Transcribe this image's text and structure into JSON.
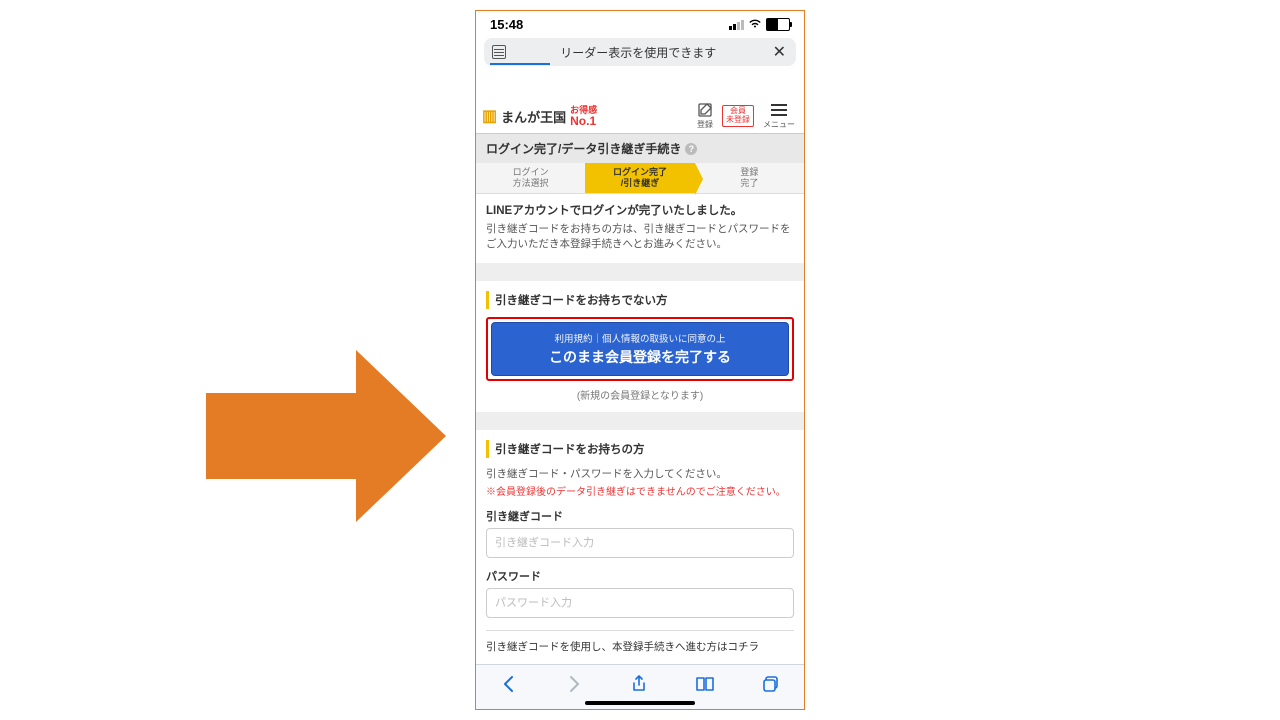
{
  "status": {
    "time": "15:48"
  },
  "urlbar": {
    "reader_text": "リーダー表示を使用できます"
  },
  "appheader": {
    "brand": "まんが王国",
    "otoku_top": "お得感",
    "otoku_bottom": "No.1",
    "register_label": "登録",
    "unregistered_badge": "会員\n未登録",
    "menu_label": "メニュー"
  },
  "page_title": "ログイン完了/データ引き継ぎ手続き",
  "steps": {
    "s1": "ログイン\n方法選択",
    "s2": "ログイン完了\n/引き継ぎ",
    "s3": "登録\n完了"
  },
  "intro": {
    "lead": "LINEアカウントでログインが完了いたしました。",
    "desc": "引き継ぎコードをお持ちの方は、引き継ぎコードとパスワードをご入力いただき本登録手続きへとお進みください。"
  },
  "no_code": {
    "heading": "引き継ぎコードをお持ちでない方",
    "btn_top": "利用規約｜個人情報の取扱いに同意の上",
    "btn_main": "このまま会員登録を完了する",
    "note": "(新規の会員登録となります)"
  },
  "has_code": {
    "heading": "引き継ぎコードをお持ちの方",
    "lead": "引き継ぎコード・パスワードを入力してください。",
    "warn": "※会員登録後のデータ引き継ぎはできませんのでご注意ください。",
    "code_label": "引き継ぎコード",
    "code_placeholder": "引き継ぎコード入力",
    "pw_label": "パスワード",
    "pw_placeholder": "パスワード入力",
    "proceed": "引き継ぎコードを使用し、本登録手続きへ進む方はコチラ"
  }
}
